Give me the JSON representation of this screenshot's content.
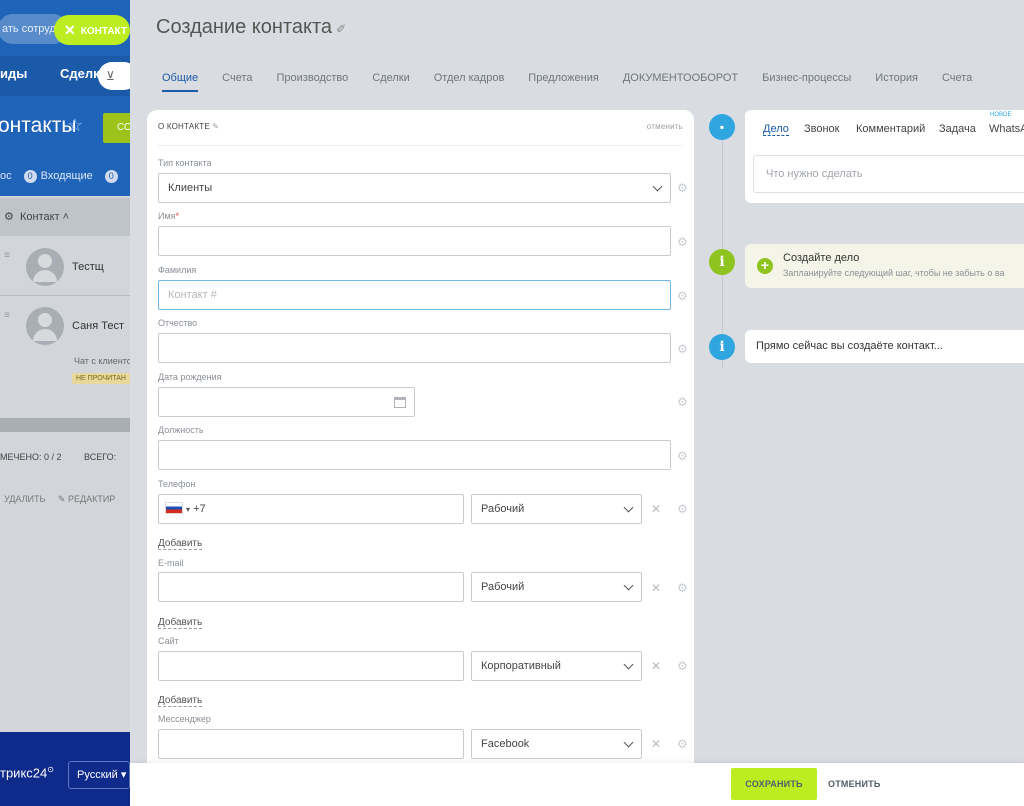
{
  "background_app": {
    "search_placeholder": "ать сотруд",
    "contact_button_label": "КОНТАКТ",
    "nav_items": [
      "иды",
      "Сделки"
    ],
    "title": "онтакты",
    "green_button": "СО",
    "filter_text": "ос",
    "filter_incoming_count": "0",
    "filter_incoming_label": "Входящие",
    "filter_other_count": "0",
    "column_header": "Контакт",
    "rows": [
      {
        "name": "Тестщ"
      },
      {
        "name": "Саня Тест"
      }
    ],
    "chat_text": "Чат с клиенто",
    "badge": "НЕ ПРОЧИТАН",
    "marked_count": "МЕЧЕНО: 0 / 2",
    "total_label": "ВСЕГО:",
    "delete_label": "УДАЛИТЬ",
    "edit_label": "РЕДАКТИР",
    "logo_text": "трикс24",
    "language": "Русский"
  },
  "slider": {
    "title": "Создание контакта",
    "tabs": [
      "Общие",
      "Счета",
      "Производство",
      "Сделки",
      "Отдел кадров",
      "Предложения",
      "ДОКУМЕНТООБОРОТ",
      "Бизнес-процессы",
      "История",
      "Счета"
    ]
  },
  "form": {
    "section_title": "О КОНТАКТЕ",
    "cancel_label": "отменить",
    "add_label": "Добавить",
    "fields": {
      "contact_type": {
        "label": "Тип контакта",
        "value": "Клиенты"
      },
      "name": {
        "label": "Имя",
        "required_mark": "*",
        "value": ""
      },
      "last_name": {
        "label": "Фамилия",
        "placeholder": "Контакт #"
      },
      "middle_name": {
        "label": "Отчество",
        "value": ""
      },
      "birth_date": {
        "label": "Дата рождения",
        "value": ""
      },
      "position": {
        "label": "Должность",
        "value": ""
      },
      "phone": {
        "label": "Телефон",
        "value": "+7",
        "type": "Рабочий",
        "flag": "ru"
      },
      "email": {
        "label": "E-mail",
        "value": "",
        "type": "Рабочий"
      },
      "site": {
        "label": "Сайт",
        "value": "",
        "type": "Корпоративный"
      },
      "messenger": {
        "label": "Мессенджер",
        "value": "",
        "type": "Facebook"
      }
    }
  },
  "timeline": {
    "tabs": [
      "Дело",
      "Звонок",
      "Комментарий",
      "Задача",
      "WhatsA"
    ],
    "new_badge": "НОВОЕ",
    "input_placeholder": "Что нужно сделать",
    "create_task_title": "Создайте дело",
    "create_task_subtitle": "Запланируйте следующий шаг, чтобы не забыть о ва",
    "info_text": "Прямо сейчас вы создаёте контакт..."
  },
  "bottom_bar": {
    "save_label": "СОХРАНИТЬ",
    "cancel_label": "ОТМЕНИТЬ"
  },
  "colors": {
    "accent_green": "#bbed21",
    "link_blue": "#1a5aa8",
    "bitrix_blue": "#2064b9",
    "timeline_blue": "#2fa6e0",
    "timeline_green": "#8fc31f"
  }
}
